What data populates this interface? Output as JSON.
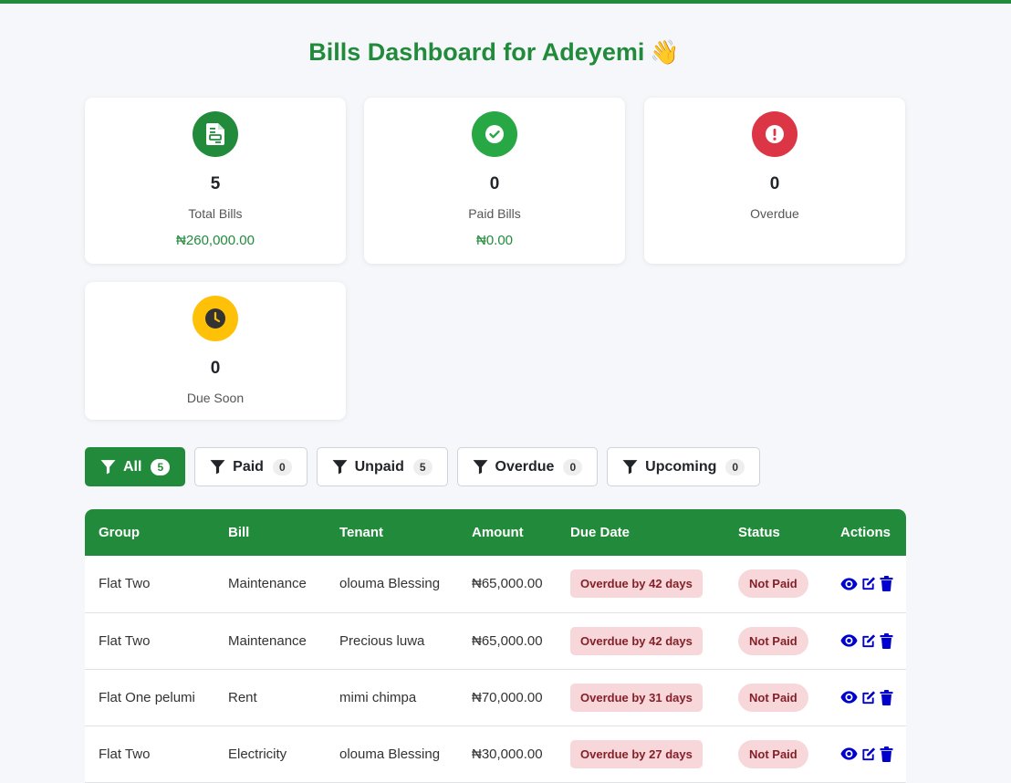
{
  "header": {
    "title": "Bills Dashboard for Adeyemi",
    "wave_emoji": "👋"
  },
  "summary": [
    {
      "icon": "file-invoice-icon",
      "count": "5",
      "label": "Total Bills",
      "amount": "₦260,000.00",
      "color": "#228b3b"
    },
    {
      "icon": "check-circle-icon",
      "count": "0",
      "label": "Paid Bills",
      "amount": "₦0.00",
      "color": "#28a745"
    },
    {
      "icon": "exclamation-circle-icon",
      "count": "0",
      "label": "Overdue",
      "amount": "",
      "color": "#dc3545"
    },
    {
      "icon": "clock-icon",
      "count": "0",
      "label": "Due Soon",
      "amount": "",
      "color": "#ffc107"
    }
  ],
  "filters": [
    {
      "label": "All",
      "count": "5",
      "active": true
    },
    {
      "label": "Paid",
      "count": "0",
      "active": false
    },
    {
      "label": "Unpaid",
      "count": "5",
      "active": false
    },
    {
      "label": "Overdue",
      "count": "0",
      "active": false
    },
    {
      "label": "Upcoming",
      "count": "0",
      "active": false
    }
  ],
  "table": {
    "columns": [
      "Group",
      "Bill",
      "Tenant",
      "Amount",
      "Due Date",
      "Status",
      "Actions"
    ],
    "rows": [
      {
        "group": "Flat Two",
        "bill": "Maintenance",
        "tenant": "olouma Blessing",
        "amount": "₦65,000.00",
        "due": "Overdue by 42 days",
        "status": "Not Paid"
      },
      {
        "group": "Flat Two",
        "bill": "Maintenance",
        "tenant": "Precious luwa",
        "amount": "₦65,000.00",
        "due": "Overdue by 42 days",
        "status": "Not Paid"
      },
      {
        "group": "Flat One pelumi",
        "bill": "Rent",
        "tenant": "mimi chimpa",
        "amount": "₦70,000.00",
        "due": "Overdue by 31 days",
        "status": "Not Paid"
      },
      {
        "group": "Flat Two",
        "bill": "Electricity",
        "tenant": "olouma Blessing",
        "amount": "₦30,000.00",
        "due": "Overdue by 27 days",
        "status": "Not Paid"
      }
    ]
  },
  "colors": {
    "brand": "#228b3b",
    "action_icon": "#0000cc",
    "danger_bg": "#f8d7da",
    "danger_text": "#842029"
  }
}
